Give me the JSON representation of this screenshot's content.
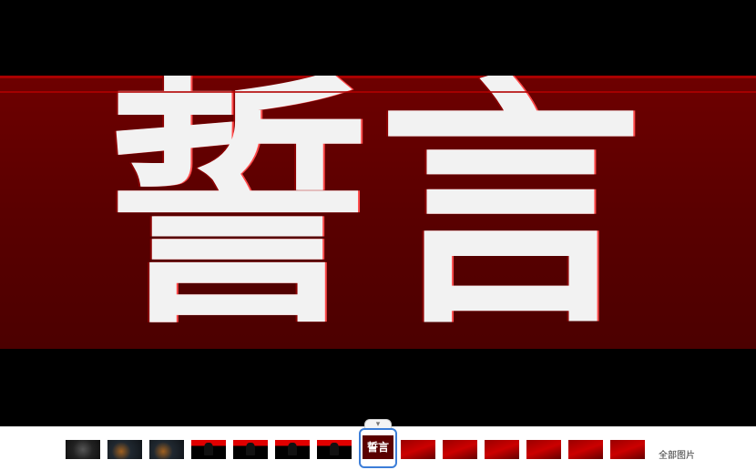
{
  "viewer": {
    "title_text": "誓言"
  },
  "thumbnails": [
    {
      "style": "dark"
    },
    {
      "style": "dark2"
    },
    {
      "style": "dark2"
    },
    {
      "style": "red"
    },
    {
      "style": "red"
    },
    {
      "style": "red"
    },
    {
      "style": "red"
    },
    {
      "style": "active",
      "label": "誓言"
    },
    {
      "style": "deep"
    },
    {
      "style": "deep"
    },
    {
      "style": "deep"
    },
    {
      "style": "deep"
    },
    {
      "style": "deep"
    },
    {
      "style": "deep"
    }
  ],
  "all_images_label": "全部图片",
  "colors": {
    "banner": "#5a0000",
    "active_border": "#3c7ed8"
  }
}
